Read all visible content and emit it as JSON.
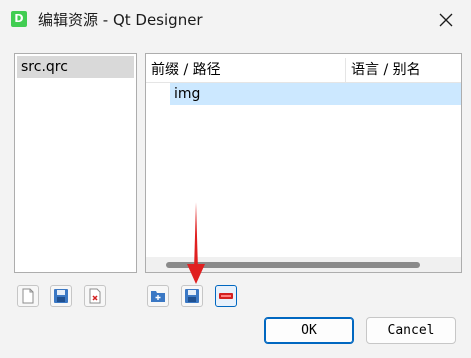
{
  "window": {
    "icon_letter": "D",
    "title": "编辑资源 - Qt Designer"
  },
  "resources": {
    "items": [
      "src.qrc"
    ]
  },
  "files": {
    "col_prefix": "前缀 / 路径",
    "col_lang": "语言 / 别名",
    "rows": [
      "img"
    ]
  },
  "toolbar_left": {
    "buttons": [
      "new-file-icon",
      "save-icon",
      "remove-file-icon"
    ]
  },
  "toolbar_right": {
    "buttons": [
      "add-prefix-icon",
      "add-files-icon",
      "remove-icon"
    ]
  },
  "dialog": {
    "ok_label": "OK",
    "cancel_label": "Cancel"
  },
  "colors": {
    "selection": "#cce8ff",
    "accent": "#0067c0",
    "annotation": "#e02020"
  }
}
